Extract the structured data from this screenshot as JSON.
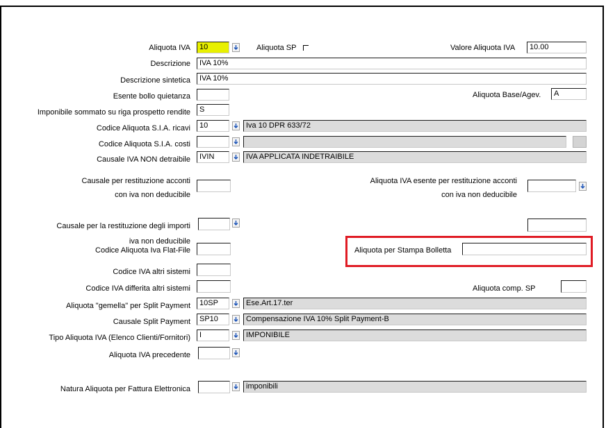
{
  "fields": {
    "aliquota_iva": {
      "label": "Aliquota IVA",
      "value": "10"
    },
    "aliquota_sp": {
      "label": "Aliquota SP"
    },
    "valore_aliquota_iva": {
      "label": "Valore Aliquota IVA",
      "value": "10.00"
    },
    "descrizione": {
      "label": "Descrizione",
      "value": "IVA 10%"
    },
    "descrizione_sintetica": {
      "label": "Descrizione sintetica",
      "value": "IVA 10%"
    },
    "esente_bollo": {
      "label": "Esente bollo quietanza",
      "value": ""
    },
    "aliquota_base": {
      "label": "Aliquota Base/Agev.",
      "value": "A"
    },
    "imponibile_sommato": {
      "label": "Imponibile sommato su riga prospetto rendite",
      "value": "S"
    },
    "codice_sia_ricavi": {
      "label": "Codice Aliquota S.I.A. ricavi",
      "value": "10",
      "desc": "Iva 10 DPR 633/72"
    },
    "codice_sia_costi": {
      "label": "Codice Aliquota S.I.A. costi",
      "value": "",
      "desc": ""
    },
    "causale_non_detraibile": {
      "label": "Causale IVA NON detraibile",
      "value": "IVIN",
      "desc": "IVA APPLICATA INDETRAIBILE"
    },
    "causale_restituzione": {
      "label1": "Causale per restituzione acconti",
      "label2": "con iva non deducibile",
      "value": ""
    },
    "aliquota_esente_restituzione": {
      "label1": "Aliquota IVA esente per restituzione acconti",
      "label2": "con  iva non deducibile",
      "value": ""
    },
    "causale_restituzione_importi": {
      "label1": "Causale per la restituzione degli importi",
      "label2": "iva non deducibile",
      "value": ""
    },
    "extra_right_field": {
      "value": ""
    },
    "codice_flat_file": {
      "label": "Codice Aliquota Iva Flat-File",
      "value": ""
    },
    "aliquota_stampa_bolletta": {
      "label": "Aliquota per Stampa Bolletta",
      "value": ""
    },
    "codice_altri_sistemi": {
      "label": "Codice IVA altri sistemi",
      "value": ""
    },
    "codice_differita": {
      "label": "Codice IVA differita altri sistemi",
      "value": ""
    },
    "aliquota_comp_sp": {
      "label": "Aliquota comp. SP",
      "value": ""
    },
    "aliquota_gemella": {
      "label": "Aliquota \"gemella\" per Split Payment",
      "value": "10SP",
      "desc": "Ese.Art.17.ter"
    },
    "causale_split": {
      "label": "Causale Split Payment",
      "value": "SP10",
      "desc": "Compensazione IVA 10% Split Payment-B"
    },
    "tipo_aliquota": {
      "label": "Tipo Aliquota IVA (Elenco Clienti/Fornitori)",
      "value": "I",
      "desc": "IMPONIBILE"
    },
    "aliquota_precedente": {
      "label": "Aliquota IVA precedente",
      "value": ""
    },
    "natura_aliquota": {
      "label": "Natura Aliquota per Fattura Elettronica",
      "value": "",
      "desc": "imponibili"
    }
  },
  "colors": {
    "highlight": "#e01b24",
    "current_field": "#e8f000",
    "readonly": "#dcdcdc"
  }
}
